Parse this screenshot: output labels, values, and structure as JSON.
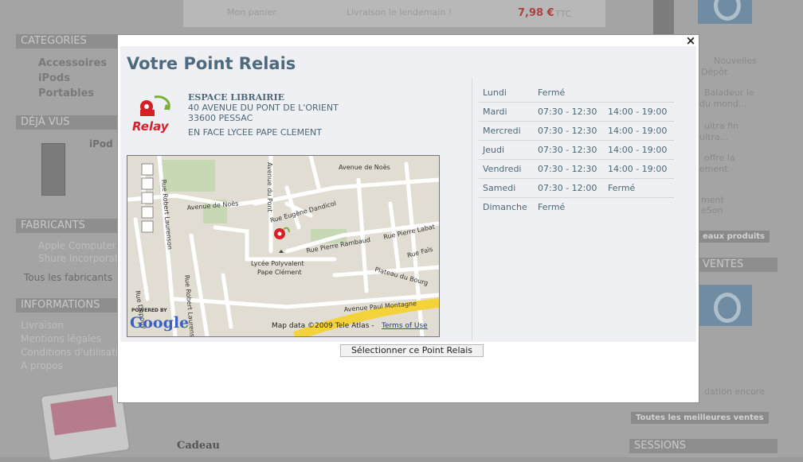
{
  "background": {
    "left_headers": [
      "CATEGORIES",
      "DÉJÀ VUS",
      "FABRICANTS",
      "INFORMATIONS"
    ],
    "categories": [
      "Accessoires",
      "iPods",
      "Portables"
    ],
    "fabricants": [
      "Apple Computer",
      "Shure Incorporated",
      "Tous les fabricants"
    ],
    "informations": [
      "Livraison",
      "Mentions légales",
      "Conditions d'utilisation",
      "A propos"
    ],
    "deja_vu_item": "iPod N",
    "top_cart": "Mon panier",
    "top_delivery": "Livraison le lendemain !",
    "top_price": "7,98 €",
    "top_price_suffix": "TTC",
    "right_links": [
      "Nouvelles",
      "Dépôt",
      "Baladeur le",
      "du mond...",
      "ultra fin",
      "ultra...",
      "offre la",
      "ement",
      "ment",
      "eSon"
    ],
    "right_button_new": "eaux produits",
    "right_header_ventes": "VENTES",
    "right_text_bottom": "dation encore",
    "right_button_best": "Toutes les meilleures ventes",
    "right_header_bottom": "SESSIONS",
    "cadeau": "Cadeau"
  },
  "modal": {
    "title": "Votre Point Relais",
    "close_label": "×",
    "logo_text": "Relay",
    "shop": {
      "name": "ESPACE LIBRAIRIE",
      "street": "40 AVENUE DU PONT DE L'ORIENT",
      "city": "33600 PESSAC",
      "note": "EN FACE LYCEE PAPE CLEMENT"
    },
    "map": {
      "streets": [
        "Avenue de Noès",
        "Avenue du Pont",
        "Avenue de Noès",
        "Rue Eugène Dandicol",
        "Rue Pierre Rambaud",
        "Rue Pierre Labat",
        "Rue Faïs",
        "Plateau du Bourg",
        "Rue Robert Laurenson",
        "Rue Robert Laurenson",
        "Rue Dupouy",
        "Avenue Paul Montagne"
      ],
      "poi": "Lycée Polyvalent",
      "poi2": "Pape Clément",
      "powered_by": "POWERED BY",
      "brand": "Google",
      "copyright": "Map data ©2009 Tele Atlas - ",
      "terms": "Terms of Use"
    },
    "hours": [
      {
        "day": "Lundi",
        "am": "Fermé",
        "pm": ""
      },
      {
        "day": "Mardi",
        "am": "07:30 - 12:30",
        "pm": "14:00 - 19:00"
      },
      {
        "day": "Mercredi",
        "am": "07:30 - 12:30",
        "pm": "14:00 - 19:00"
      },
      {
        "day": "Jeudi",
        "am": "07:30 - 12:30",
        "pm": "14:00 - 19:00"
      },
      {
        "day": "Vendredi",
        "am": "07:30 - 12:30",
        "pm": "14:00 - 19:00"
      },
      {
        "day": "Samedi",
        "am": "07:30 - 12:00",
        "pm": "Fermé"
      },
      {
        "day": "Dimanche",
        "am": "Fermé",
        "pm": ""
      }
    ],
    "select_button": "Sélectionner ce Point Relais"
  }
}
